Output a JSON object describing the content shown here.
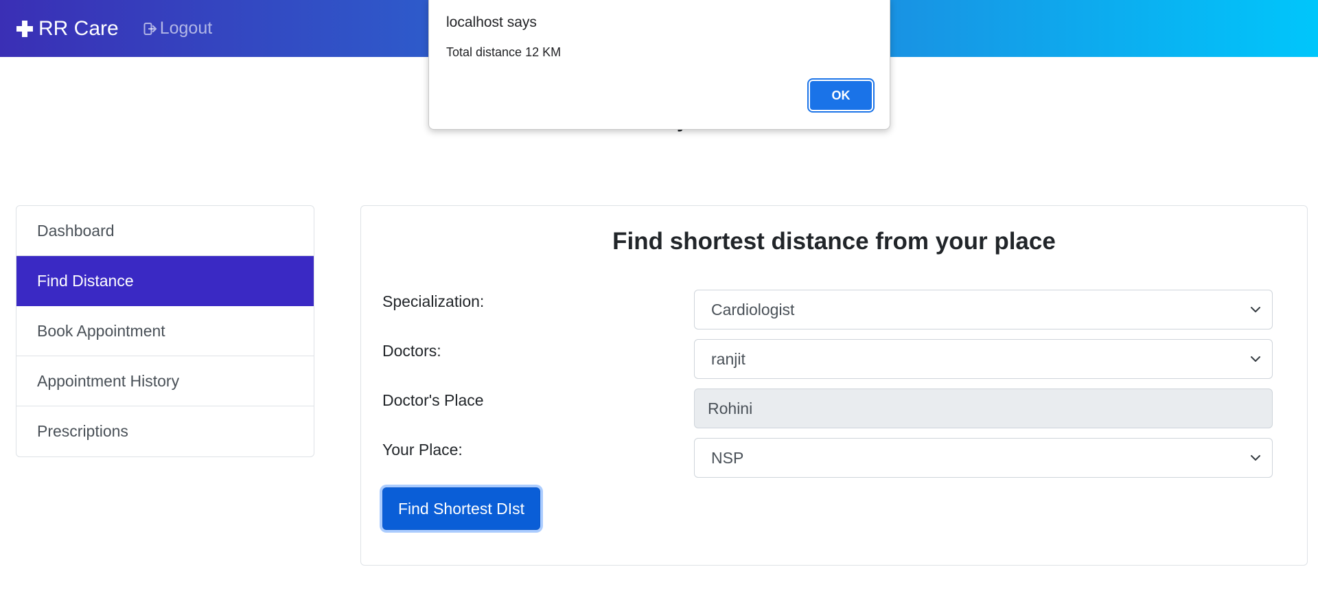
{
  "header": {
    "brand_label": "RR Care",
    "logout_label": "Logout"
  },
  "welcome_text": "Welcome  Ranjeet Handa",
  "sidebar": {
    "items": [
      {
        "label": "Dashboard",
        "active": false
      },
      {
        "label": "Find Distance",
        "active": true
      },
      {
        "label": "Book Appointment",
        "active": false
      },
      {
        "label": "Appointment History",
        "active": false
      },
      {
        "label": "Prescriptions",
        "active": false
      }
    ]
  },
  "form": {
    "title": "Find shortest distance from your place",
    "specialization": {
      "label": "Specialization:",
      "value": "Cardiologist"
    },
    "doctors": {
      "label": "Doctors:",
      "value": "ranjit"
    },
    "doctor_place": {
      "label": "Doctor's Place",
      "value": "Rohini"
    },
    "your_place": {
      "label": "Your Place:",
      "value": "NSP"
    },
    "submit_label": "Find Shortest DIst"
  },
  "alert": {
    "title": "localhost says",
    "message": "Total distance 12 KM",
    "ok_label": "OK"
  },
  "colors": {
    "header_gradient_start": "#3a2fb5",
    "header_gradient_end": "#00c6fb",
    "sidebar_active": "#3a29c4",
    "primary_button": "#0a5ed7",
    "alert_ok": "#1a73e8"
  },
  "icons": {
    "brand": "plus-icon",
    "logout": "logout-icon",
    "select": "chevron-down-icon"
  }
}
